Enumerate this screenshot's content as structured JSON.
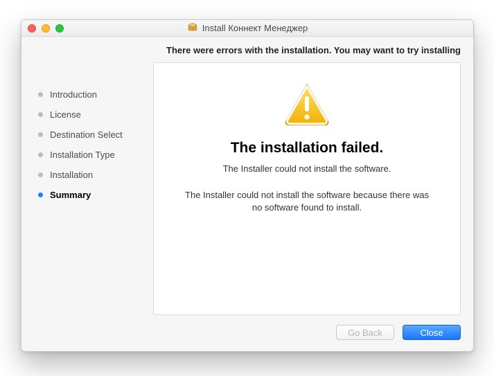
{
  "window": {
    "title": "Install Коннект Менеджер"
  },
  "banner": "There were errors with the installation. You may want to try installing",
  "sidebar": {
    "items": [
      {
        "label": "Introduction",
        "active": false
      },
      {
        "label": "License",
        "active": false
      },
      {
        "label": "Destination Select",
        "active": false
      },
      {
        "label": "Installation Type",
        "active": false
      },
      {
        "label": "Installation",
        "active": false
      },
      {
        "label": "Summary",
        "active": true
      }
    ]
  },
  "main": {
    "headline": "The installation failed.",
    "subline": "The Installer could not install the software.",
    "detail": "The Installer could not install the software because there was no software found to install."
  },
  "footer": {
    "back_label": "Go Back",
    "close_label": "Close"
  },
  "icons": {
    "package": "package-icon",
    "warning": "warning-icon"
  },
  "colors": {
    "accent": "#1a82ff",
    "warning": "#f7c948"
  }
}
